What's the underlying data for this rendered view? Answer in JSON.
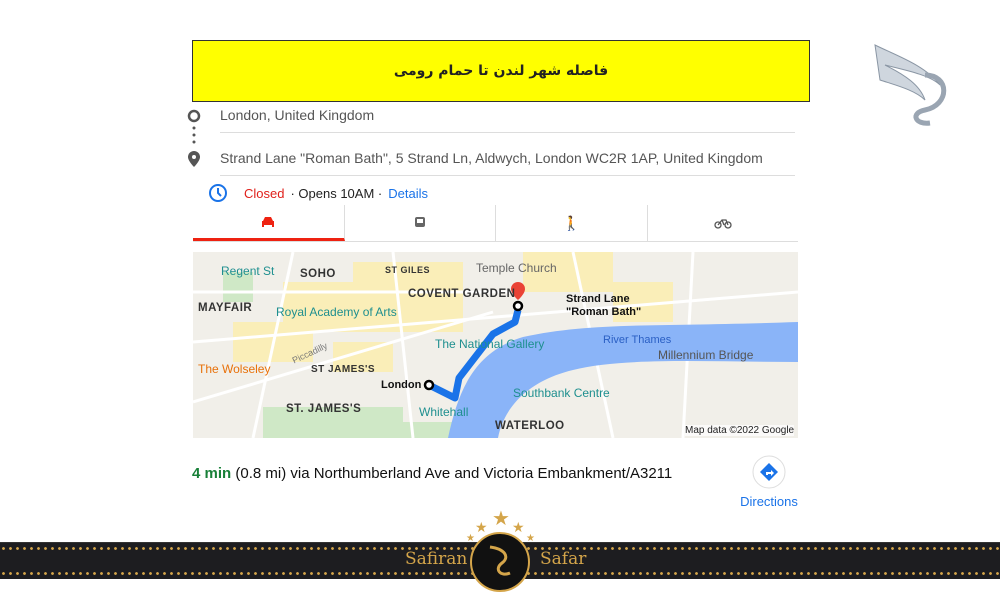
{
  "banner": {
    "title": "فاصله شهر لندن تا حمام رومی"
  },
  "route": {
    "origin": "London, United Kingdom",
    "destination": "Strand Lane \"Roman Bath\", 5 Strand Ln, Aldwych, London WC2R 1AP, United Kingdom"
  },
  "hours": {
    "status": "Closed",
    "status_color": "#e0201b",
    "opens": "· Opens 10AM ·",
    "details": "Details"
  },
  "tabs": [
    {
      "icon": "car-icon",
      "active": true
    },
    {
      "icon": "train-icon"
    },
    {
      "icon": "walk-icon"
    },
    {
      "icon": "bike-icon"
    }
  ],
  "map": {
    "labels": {
      "regent_st": "Regent St",
      "soho": "SOHO",
      "st_giles": "ST GILES",
      "temple_church": "Temple Church",
      "covent_garden": "COVENT GARDEN",
      "strand_lane": "Strand Lane",
      "roman_bath": "\"Roman Bath\"",
      "mayfair": "MAYFAIR",
      "royal_academy": "Royal Academy of Arts",
      "river_thames": "River Thames",
      "millennium_bridge": "Millennium Bridge",
      "national_gallery": "The National Gallery",
      "wolseley": "The Wolseley",
      "st_james": "ST JAMES'S",
      "london": "London",
      "piccadilly": "Piccadilly",
      "southbank": "Southbank Centre",
      "st_james2": "ST. JAMES'S",
      "whitehall": "Whitehall",
      "waterloo": "WATERLOO",
      "attribution": "Map data ©2022 Google"
    },
    "route_color": "#1a73e8"
  },
  "summary": {
    "time": "4 min",
    "time_color": "#188038",
    "rest": " (0.8 mi) via Northumberland Ave and Victoria Embankment/A3211"
  },
  "directions": {
    "label": "Directions"
  },
  "footer": {
    "left": "Safiran",
    "right": "Safar",
    "accent": "#d4a54a"
  }
}
